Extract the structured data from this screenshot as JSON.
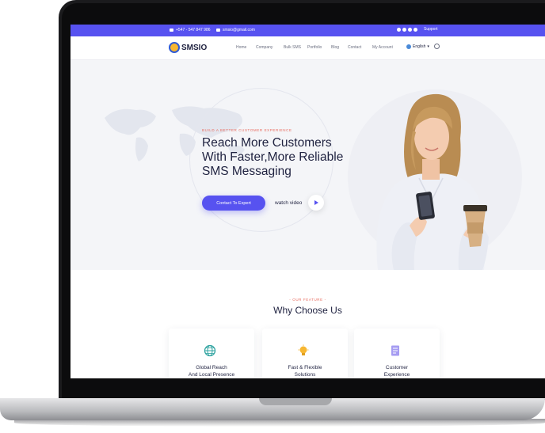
{
  "topbar": {
    "phone": "+547 - 547 847 986",
    "email": "smsio@gmail.com",
    "support": "Support",
    "social_icons": [
      "facebook-icon",
      "twitter-icon",
      "instagram-icon",
      "linkedin-icon"
    ]
  },
  "navbar": {
    "brand": "SMSIO",
    "items": [
      "Home",
      "Company",
      "Bulk SMS",
      "Portfolio",
      "Blog",
      "Contact",
      "My Account"
    ],
    "language": "English"
  },
  "hero": {
    "eyebrow": "BUILD A BETTER CUSTOMER EXPERIENCE",
    "title_line1": "Reach More Customers",
    "title_line2": "With Faster,More Reliable",
    "title_line3": "SMS Messaging",
    "cta": "Contact To Expert",
    "watch_label": "watch video"
  },
  "features": {
    "eyebrow": "- OUR FEATURE -",
    "title": "Why Choose Us",
    "cards": [
      {
        "line1": "Global Reach",
        "line2": "And Local Presence",
        "icon": "globe-icon"
      },
      {
        "line1": "Fast & Flexible",
        "line2": "Solutions",
        "icon": "lightbulb-icon"
      },
      {
        "line1": "Customer",
        "line2": "Experience",
        "icon": "document-icon"
      }
    ]
  },
  "colors": {
    "primary": "#5752f0",
    "accent": "#e8695c",
    "heading": "#1f2240"
  }
}
